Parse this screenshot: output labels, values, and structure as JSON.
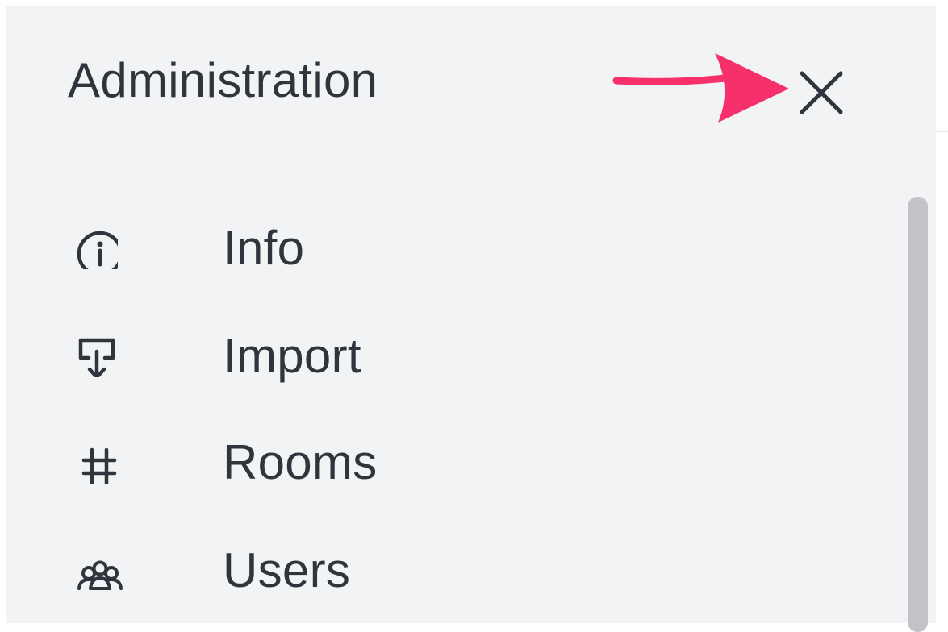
{
  "panel": {
    "title": "Administration",
    "close_icon": "close-icon"
  },
  "annotation": {
    "color": "#f5306a",
    "icon": "arrow-right-annotation"
  },
  "menu": {
    "items": [
      {
        "label": "Info",
        "icon": "info-circle-icon"
      },
      {
        "label": "Import",
        "icon": "import-icon"
      },
      {
        "label": "Rooms",
        "icon": "hashtag-icon"
      },
      {
        "label": "Users",
        "icon": "team-icon"
      }
    ]
  },
  "colors": {
    "panel_bg": "#f2f3f5",
    "text": "#2f343d",
    "scrollbar": "#c2c3c6"
  }
}
